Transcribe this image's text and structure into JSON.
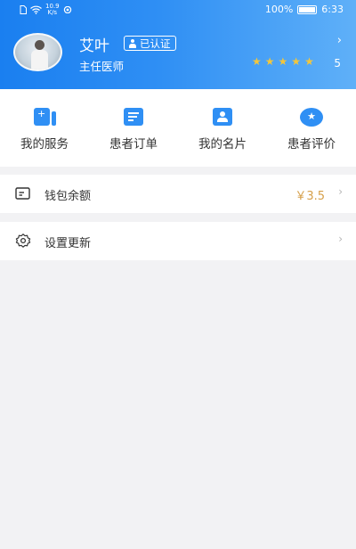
{
  "status_bar": {
    "net_speed_value": "10.9",
    "net_speed_unit": "K/s",
    "battery_percent": "100%",
    "time": "6:33"
  },
  "profile": {
    "name": "艾叶",
    "verified_label": "已认证",
    "title": "主任医师",
    "rating_value": "5",
    "stars_filled": 5,
    "header_arrow": "›"
  },
  "quick_actions": [
    {
      "label": "我的服务",
      "icon": "service-icon"
    },
    {
      "label": "患者订单",
      "icon": "order-icon"
    },
    {
      "label": "我的名片",
      "icon": "card-icon"
    },
    {
      "label": "患者评价",
      "icon": "evaluation-icon"
    }
  ],
  "wallet": {
    "label": "钱包余额",
    "value": "￥3.5",
    "icon": "wallet-icon"
  },
  "settings": {
    "label": "设置更新",
    "icon": "gear-icon"
  },
  "colors": {
    "primary": "#2f8ff4",
    "star": "#f3c63b",
    "amount": "#d6a04b",
    "background": "#f2f2f4"
  }
}
